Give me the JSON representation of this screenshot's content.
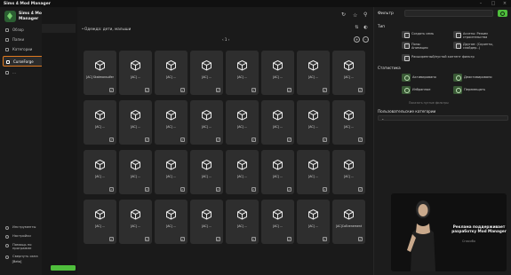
{
  "app": {
    "title": "Sims 4 Mod Manager",
    "subtitle": "",
    "brand_name": "Sims 4 Mod Manager",
    "accent": "#4fbe3c",
    "active_nav_border": "#e07a1f"
  },
  "sidebar": {
    "items": [
      {
        "label": "Обзор",
        "icon": "home-icon"
      },
      {
        "label": "Папки",
        "icon": "folder-icon"
      },
      {
        "label": "Категории",
        "icon": "tag-icon"
      },
      {
        "label": "CurseForge",
        "icon": "curseforge-icon"
      },
      {
        "label": "…",
        "icon": "list-icon"
      }
    ],
    "bottom_items": [
      {
        "label": "Инструменты",
        "icon": "tools-icon"
      },
      {
        "label": "Настройки",
        "icon": "gear-icon"
      },
      {
        "label": "Помощь по программе",
        "icon": "help-icon"
      },
      {
        "label": "Свернуть окна",
        "icon": "collapse-icon"
      }
    ],
    "version_label": "[Beta]",
    "version_number": ""
  },
  "left_panel": {
    "progress_text": "",
    "update_button_label": ""
  },
  "main": {
    "group_header": "Одежда: дети, малыши",
    "pager_text": "1",
    "cards": [
      {
        "name": "[AC] Skatmansulfer",
        "checked": true
      },
      {
        "name": "[AC] …",
        "checked": true
      },
      {
        "name": "[AC] …",
        "checked": true
      },
      {
        "name": "[AC] …",
        "checked": true
      },
      {
        "name": "[AC] …",
        "checked": true
      },
      {
        "name": "[AC] …",
        "checked": true
      },
      {
        "name": "[AC] …",
        "checked": true
      },
      {
        "name": "[AC] …",
        "checked": true
      },
      {
        "name": "[AC] …",
        "checked": true
      },
      {
        "name": "[AC] …",
        "checked": true
      },
      {
        "name": "[AC] …",
        "checked": true
      },
      {
        "name": "[AC] …",
        "checked": true
      },
      {
        "name": "[AC] …",
        "checked": true
      },
      {
        "name": "[AC] …",
        "checked": true
      },
      {
        "name": "[AC] …",
        "checked": true
      },
      {
        "name": "[AC] …",
        "checked": true
      },
      {
        "name": "[AC] …",
        "checked": true
      },
      {
        "name": "[AC] …",
        "checked": true
      },
      {
        "name": "[AC] …",
        "checked": true
      },
      {
        "name": "[AC] …",
        "checked": true
      },
      {
        "name": "[AC] …",
        "checked": true
      },
      {
        "name": "[AC] …",
        "checked": true
      },
      {
        "name": "[AC] …",
        "checked": true
      },
      {
        "name": "[AC] …",
        "checked": true
      },
      {
        "name": "[AC] …",
        "checked": true
      },
      {
        "name": "[AC] …",
        "checked": true
      },
      {
        "name": "[AC] …",
        "checked": true
      },
      {
        "name": "[AC] …",
        "checked": true
      },
      {
        "name": "[AC] …",
        "checked": true
      },
      {
        "name": "[AC] …",
        "checked": true
      },
      {
        "name": "[AC] …",
        "checked": true
      },
      {
        "name": "[AC]CoEvenement",
        "checked": true
      },
      {
        "name": "[AC] …",
        "checked": true
      },
      {
        "name": "[AC] …",
        "checked": true
      }
    ]
  },
  "right_panel": {
    "filter_label": "Фильтр",
    "search_placeholder": "",
    "type_label": "Тип",
    "type_options": [
      {
        "label": "Создать семь",
        "icon": "family-icon"
      },
      {
        "label": "Ассеты: Режим строительства",
        "icon": "build-icon"
      },
      {
        "label": "Позы: Анимация",
        "icon": "pose-icon"
      },
      {
        "label": "Другое: (Скрипты, слайдер..)",
        "icon": "other-icon"
      },
      {
        "label": "Расширенный/пустой контент фильтр",
        "icon": "extended-icon"
      }
    ],
    "stats_label": "Статистика",
    "stats": [
      {
        "label": "Активировано",
        "icon": "active-icon"
      },
      {
        "label": "Деактивировано",
        "icon": "inactive-icon"
      },
      {
        "label": "Избранное",
        "icon": "favorite-icon"
      },
      {
        "label": "Перемещать",
        "icon": "move-icon"
      }
    ],
    "show_empty_text": "Показать пустые фильтры",
    "user_categories_label": "Пользовательские категории",
    "user_categories_value": ""
  },
  "ad": {
    "title": "Реклама поддерживает разработку Mod Manager",
    "subtitle": "Спасибо",
    "link": ""
  }
}
